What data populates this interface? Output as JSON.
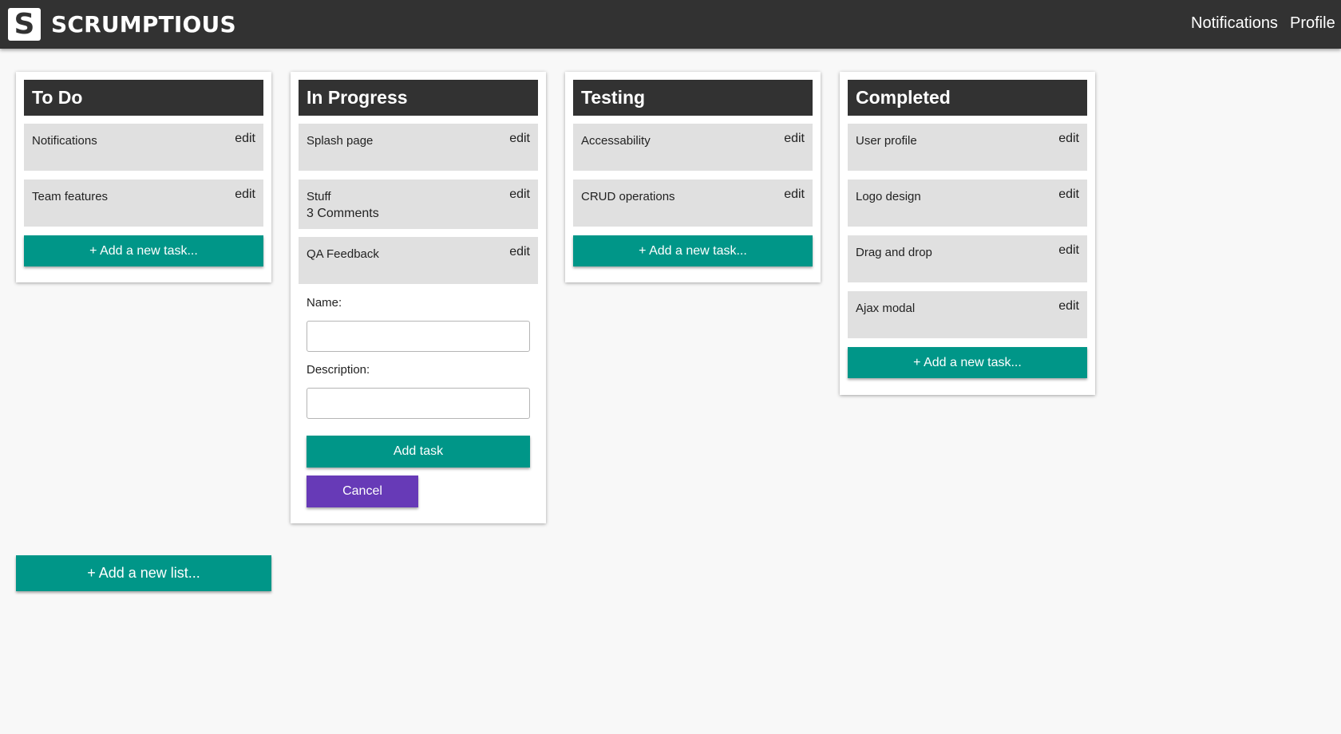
{
  "header": {
    "logo_letter": "S",
    "brand": "SCRUMPTIOUS",
    "nav": [
      "Notifications",
      "Profile"
    ]
  },
  "colors": {
    "header_bg": "#323232",
    "card_bg": "#e0e0e0",
    "primary_teal": "#009688",
    "cancel_purple": "#673ab7",
    "page_bg": "#f8f8f8"
  },
  "edit_label": "edit",
  "add_task_label": "+ Add a new task...",
  "lists": [
    {
      "title": "To Do",
      "cards": [
        {
          "name": "Notifications"
        },
        {
          "name": "Team features"
        }
      ]
    },
    {
      "title": "In Progress",
      "cards": [
        {
          "name": "Splash page"
        },
        {
          "name": "Stuff",
          "comments": "3 Comments"
        },
        {
          "name": "QA Feedback"
        }
      ],
      "form": {
        "name_label": "Name:",
        "name_value": "",
        "description_label": "Description:",
        "description_value": "",
        "submit_label": "Add task",
        "cancel_label": "Cancel"
      }
    },
    {
      "title": "Testing",
      "cards": [
        {
          "name": "Accessability"
        },
        {
          "name": "CRUD operations"
        }
      ]
    },
    {
      "title": "Completed",
      "cards": [
        {
          "name": "User profile"
        },
        {
          "name": "Logo design"
        },
        {
          "name": "Drag and drop"
        },
        {
          "name": "Ajax modal"
        }
      ]
    }
  ],
  "add_list_label": "+ Add a new list..."
}
